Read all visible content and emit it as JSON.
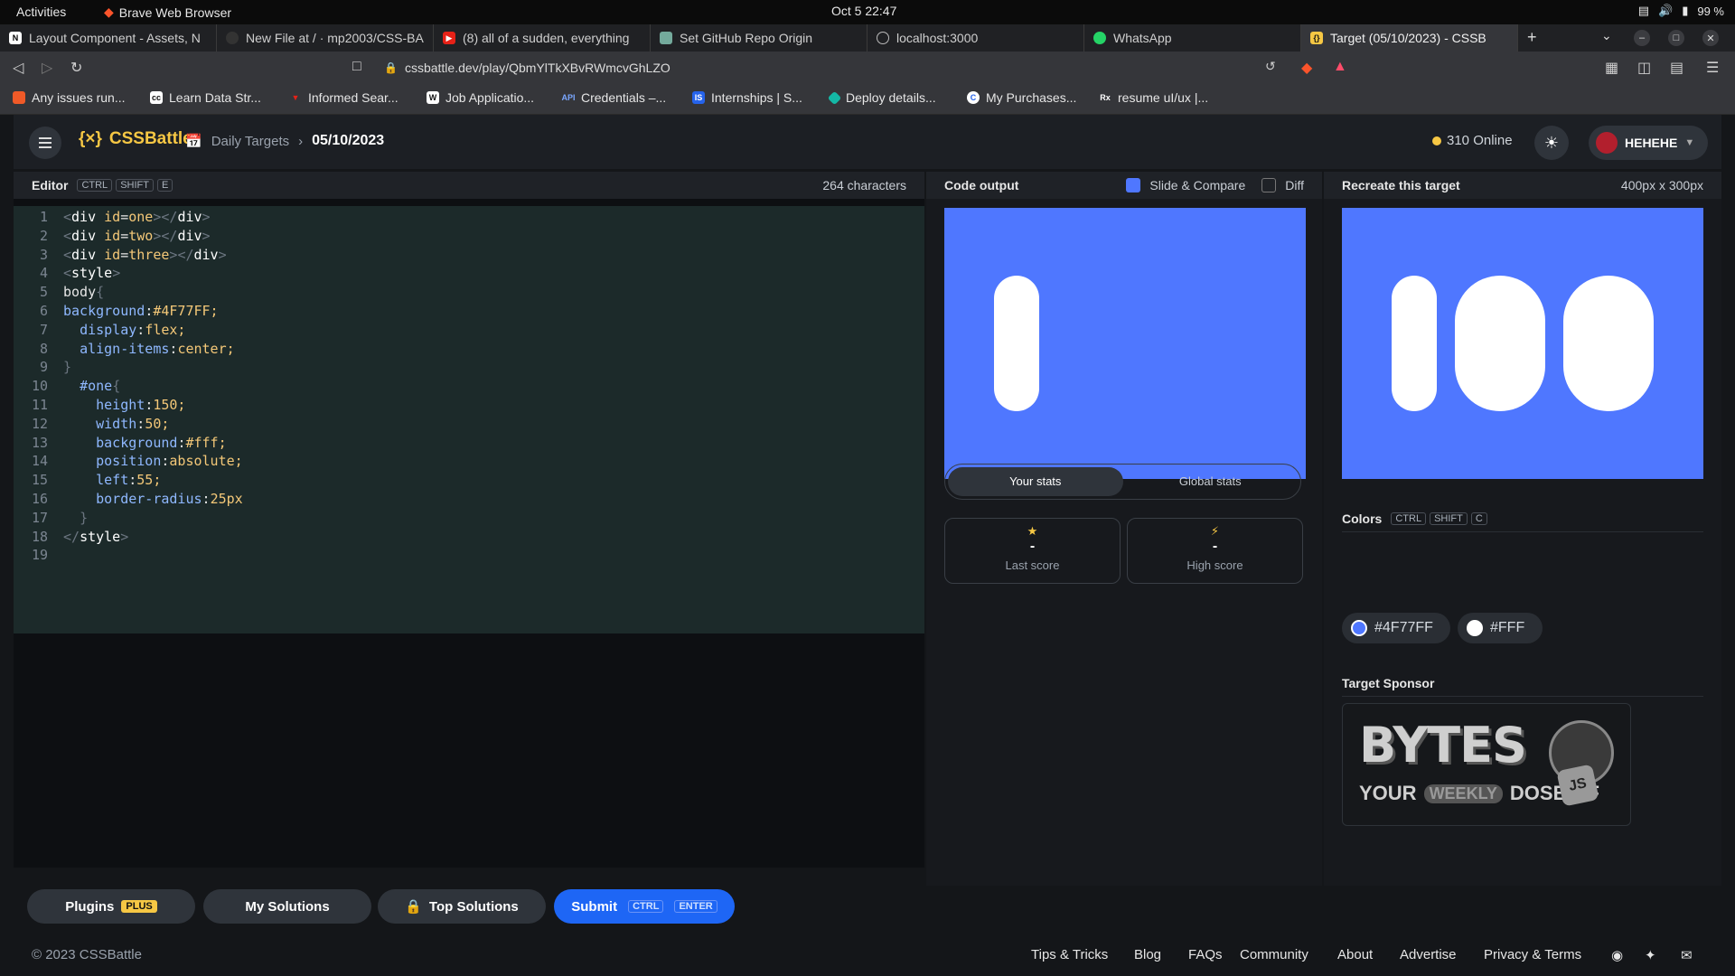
{
  "system": {
    "activities": "Activities",
    "app": "Brave Web Browser",
    "clock": "Oct 5  22:47",
    "battery": "99 %"
  },
  "tabs": [
    {
      "label": "Layout Component - Assets, N",
      "icon": "N"
    },
    {
      "label": "New File at / · mp2003/CSS-BA",
      "icon": "github"
    },
    {
      "label": "(8) all of a sudden, everything",
      "icon": "youtube"
    },
    {
      "label": "Set GitHub Repo Origin",
      "icon": "chatgpt"
    },
    {
      "label": "localhost:3000",
      "icon": "globe"
    },
    {
      "label": "WhatsApp",
      "icon": "whatsapp"
    },
    {
      "label": "Target (05/10/2023) - CSSB",
      "icon": "cssbattle"
    }
  ],
  "url": "cssbattle.dev/play/QbmYlTkXBvRWmcvGhLZO",
  "bookmarks": [
    "Any issues run...",
    "Learn Data Str...",
    "Informed Sear...",
    "Job Applicatio...",
    "Credentials –...",
    "Internships | S...",
    "Deploy details...",
    "My Purchases...",
    "resume uI/ux |..."
  ],
  "header": {
    "logo": "CSSBattle",
    "crumb_parent": "Daily Targets",
    "crumb_current": "05/10/2023",
    "online": "310 Online",
    "user": "HEHEHE"
  },
  "editor": {
    "title": "Editor",
    "keys": [
      "CTRL",
      "SHIFT",
      "E"
    ],
    "char_count": "264 characters"
  },
  "output": {
    "title": "Code output",
    "slide_compare": "Slide & Compare",
    "diff": "Diff"
  },
  "target": {
    "title": "Recreate this target",
    "size": "400px x 300px",
    "colors_title": "Colors",
    "color_keys": [
      "CTRL",
      "SHIFT",
      "C"
    ],
    "colors": [
      "#4F77FF",
      "#FFF"
    ],
    "sponsor_title": "Target Sponsor",
    "sponsor_line1": "BYTES",
    "sponsor_line2": "YOUR",
    "sponsor_line3": "WEEKLY",
    "sponsor_line4": "DOSE OF",
    "sponsor_line5": "JS"
  },
  "stats": {
    "tab_yours": "Your stats",
    "tab_global": "Global stats",
    "last_value": "-",
    "last_label": "Last score",
    "high_value": "-",
    "high_label": "High score"
  },
  "buttons": {
    "plugins": "Plugins",
    "plus": "PLUS",
    "my_solutions": "My Solutions",
    "top_solutions": "Top Solutions",
    "submit": "Submit",
    "submit_keys": [
      "CTRL",
      "ENTER"
    ]
  },
  "footer": {
    "copyright": "© 2023 CSSBattle",
    "links": [
      "Tips & Tricks",
      "Blog",
      "FAQs",
      "Community",
      "About",
      "Advertise",
      "Privacy & Terms"
    ]
  },
  "code_lines": [
    "<div id=one></div>",
    "<div id=two></div>",
    "<div id=three></div>",
    "<style>",
    "body{",
    "background:#4F77FF;",
    "  display:flex;",
    "  align-items:center;",
    "}",
    "  #one{",
    "    height:150;",
    "    width:50;",
    "    background:#fff;",
    "    position:absolute;",
    "    left:55;",
    "    border-radius:25px",
    "  }",
    "</style>",
    ""
  ]
}
